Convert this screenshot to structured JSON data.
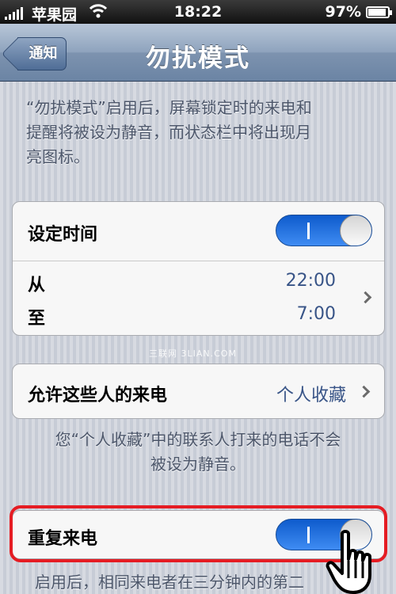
{
  "status_bar": {
    "carrier": "苹果园",
    "time": "18:22",
    "battery": "97%"
  },
  "nav": {
    "back_label": "通知",
    "title": "勿扰模式"
  },
  "intro": {
    "line1": "“勿扰模式”启用后，屏幕锁定时的来电和",
    "line2": "提醒将被设为静音，而状态栏中将出现月",
    "line3": "亮图标。"
  },
  "schedule": {
    "label": "设定时间",
    "enabled": true,
    "toggle_on_mark": "I",
    "from_label": "从",
    "from_value": "22:00",
    "to_label": "至",
    "to_value": "7:00"
  },
  "watermark": "三联网 3LIAN.COM",
  "allow_calls": {
    "label": "允许这些人的来电",
    "value": "个人收藏"
  },
  "allow_note": {
    "line1": "您“个人收藏”中的联系人打来的电话不会",
    "line2": "被设为静音。"
  },
  "repeated_calls": {
    "label": "重复来电",
    "enabled": true,
    "toggle_on_mark": "I"
  },
  "repeat_note": {
    "line1": "启用后，相同来电者在三分钟内的第二"
  },
  "colors": {
    "toggle_on": "#1a6ae0",
    "highlight": "#e51c23",
    "nav_bar": "#7d93af",
    "value_text": "#385487"
  },
  "icons": [
    "signal-icon",
    "wifi-icon",
    "battery-icon",
    "chevron-right-icon",
    "hand-pointer-icon"
  ]
}
